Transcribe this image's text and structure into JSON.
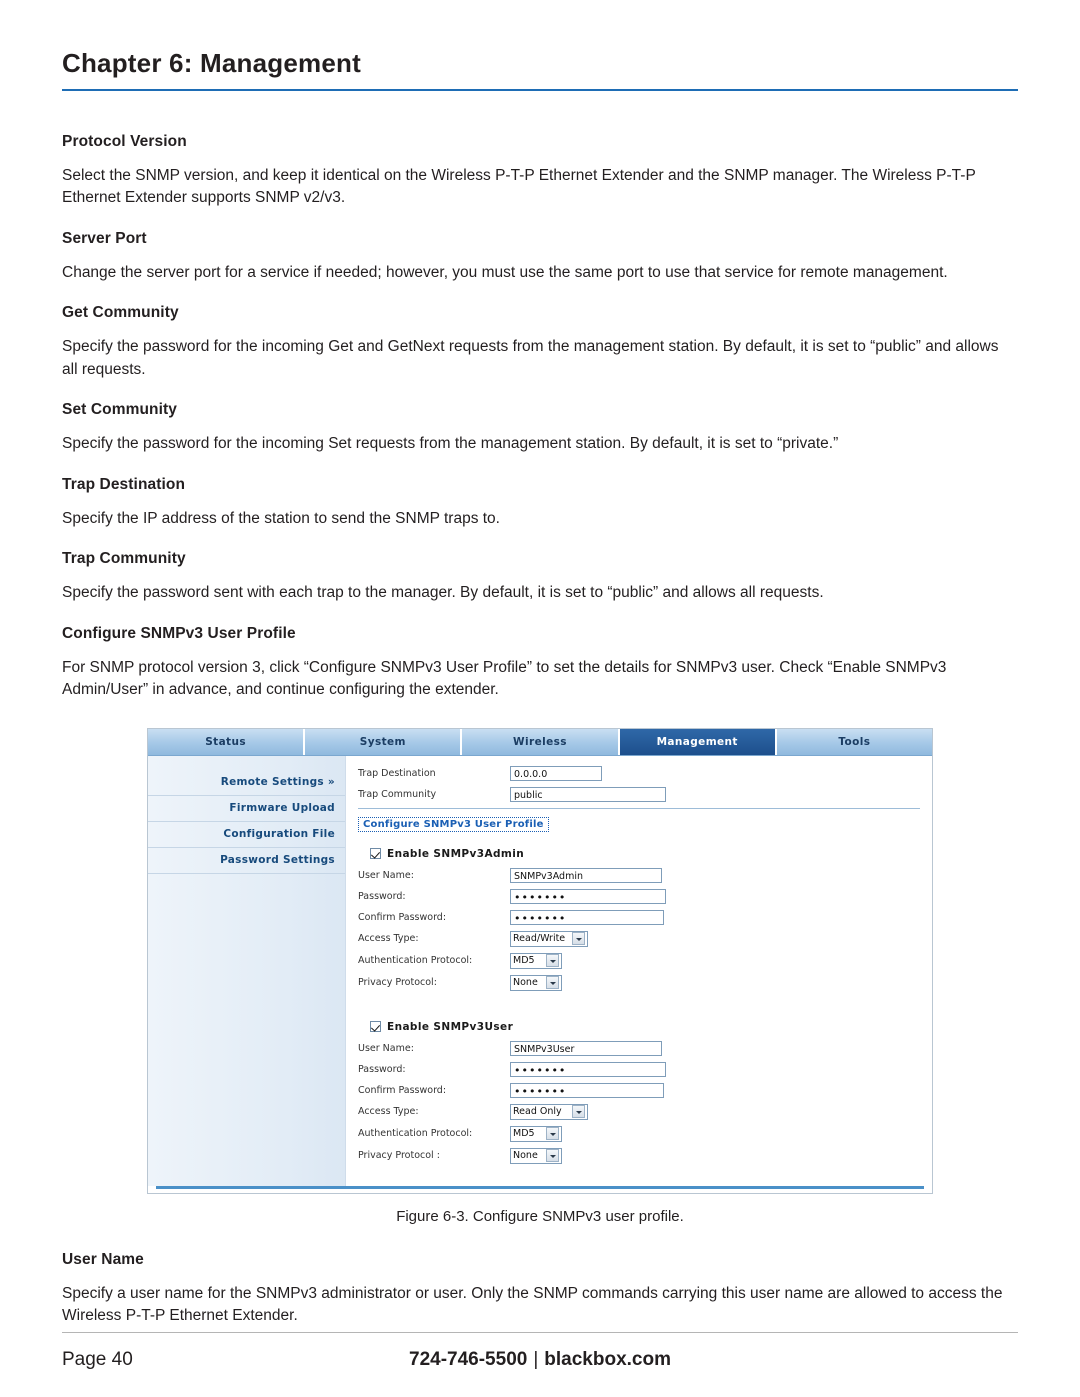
{
  "header": {
    "chapter_title": "Chapter 6: Management"
  },
  "sections": [
    {
      "heading": "Protocol Version",
      "body": "Select the SNMP version, and keep it identical on the Wireless P-T-P Ethernet Extender and the SNMP manager. The Wireless P-T-P Ethernet Extender supports SNMP v2/v3."
    },
    {
      "heading": "Server Port",
      "body": "Change the server port for a service if needed; however, you must use the same port to use that service for remote management."
    },
    {
      "heading": "Get Community",
      "body": "Specify the password for the incoming Get and GetNext requests from the management station. By default, it is set to “public” and allows all requests."
    },
    {
      "heading": "Set Community",
      "body": "Specify the password for the incoming Set requests from the management station. By default, it is set to “private.”"
    },
    {
      "heading": "Trap Destination",
      "body": "Specify the IP address of the station to send the SNMP traps to."
    },
    {
      "heading": "Trap Community",
      "body": "Specify the password sent with each trap to the manager. By default, it is set to “public” and allows all requests."
    },
    {
      "heading": "Configure SNMPv3 User Profile",
      "body": "For SNMP protocol version 3,  click “Configure SNMPv3 User Profile” to set the details for SNMPv3 user. Check “Enable SNMPv3 Admin/User” in advance, and continue configuring the extender."
    }
  ],
  "figure": {
    "caption": "Figure 6-3. Configure SNMPv3 user profile.",
    "tabs": [
      {
        "label": "Status",
        "active": false
      },
      {
        "label": "System",
        "active": false
      },
      {
        "label": "Wireless",
        "active": false
      },
      {
        "label": "Management",
        "active": true
      },
      {
        "label": "Tools",
        "active": false
      }
    ],
    "sidebar": [
      {
        "label": "Remote Settings »"
      },
      {
        "label": "Firmware Upload"
      },
      {
        "label": "Configuration File"
      },
      {
        "label": "Password Settings"
      }
    ],
    "trap": {
      "destination_label": "Trap Destination",
      "destination_value": "0.0.0.0",
      "community_label": "Trap Community",
      "community_value": "public"
    },
    "profile_link": "Configure SNMPv3 User Profile",
    "admin": {
      "enable_label": "Enable SNMPv3Admin",
      "rows": [
        {
          "label": "User Name:",
          "value": "SNMPv3Admin",
          "type": "text"
        },
        {
          "label": "Password:",
          "value": "•••••••",
          "type": "password"
        },
        {
          "label": "Confirm Password:",
          "value": "•••••••",
          "type": "password"
        },
        {
          "label": "Access Type:",
          "value": "Read/Write",
          "type": "select"
        },
        {
          "label": "Authentication Protocol:",
          "value": "MD5",
          "type": "select"
        },
        {
          "label": "Privacy Protocol:",
          "value": "None",
          "type": "select"
        }
      ]
    },
    "user": {
      "enable_label": "Enable SNMPv3User",
      "rows": [
        {
          "label": "User Name:",
          "value": "SNMPv3User",
          "type": "text"
        },
        {
          "label": "Password:",
          "value": "•••••••",
          "type": "password"
        },
        {
          "label": "Confirm Password:",
          "value": "•••••••",
          "type": "password"
        },
        {
          "label": "Access Type:",
          "value": "Read Only",
          "type": "select"
        },
        {
          "label": "Authentication Protocol:",
          "value": "MD5",
          "type": "select"
        },
        {
          "label": "Privacy Protocol :",
          "value": "None",
          "type": "select"
        }
      ]
    }
  },
  "after_figure": {
    "heading": "User Name",
    "body": "Specify a user name for the SNMPv3 administrator or user. Only the SNMP commands carrying this user name are allowed to access the Wireless P-T-P Ethernet Extender."
  },
  "footer": {
    "page": "Page 40",
    "phone": "724-746-5500",
    "separator": "|",
    "site": "blackbox.com"
  },
  "colors": {
    "accent": "#1e6db5",
    "tab_active": "#1d4f8c",
    "link": "#1a5fb4"
  }
}
